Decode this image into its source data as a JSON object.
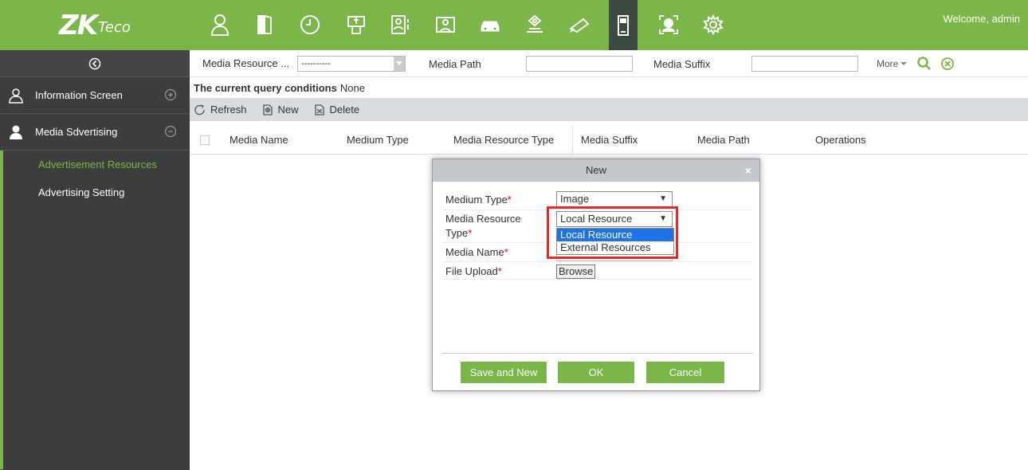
{
  "header": {
    "logo_main": "ZK",
    "logo_sub": "Teco",
    "welcome": "Welcome, admin",
    "nav_icons": [
      "personnel-icon",
      "door-icon",
      "clock-icon",
      "elevator-icon",
      "visitor-icon",
      "meeting-icon",
      "car-icon",
      "patrol-icon",
      "surveillance-icon",
      "media-screen-icon",
      "face-icon",
      "settings-icon"
    ]
  },
  "sidebar": {
    "sections": [
      {
        "label": "Information Screen",
        "expanded": false
      },
      {
        "label": "Media Sdvertising",
        "expanded": true
      }
    ],
    "sub_items": [
      {
        "label": "Advertisement Resources",
        "active": true
      },
      {
        "label": "Advertising Setting",
        "active": false
      }
    ]
  },
  "filter": {
    "media_resource_label": "Media Resource ...",
    "media_resource_value": "----------",
    "media_path_label": "Media Path",
    "media_suffix_label": "Media Suffix",
    "more_label": "More"
  },
  "query": {
    "prefix": "The current query conditions",
    "value": "None"
  },
  "toolbar": {
    "refresh": "Refresh",
    "new": "New",
    "delete": "Delete"
  },
  "table": {
    "columns": [
      "Media Name",
      "Medium Type",
      "Media Resource Type",
      "Media Suffix",
      "Media Path",
      "Operations"
    ]
  },
  "modal": {
    "title": "New",
    "medium_type_label": "Medium Type",
    "medium_type_value": "Image",
    "resource_type_label_1": "Media Resource",
    "resource_type_label_2": "Type",
    "resource_type_value": "Local Resource",
    "resource_options": [
      "Local Resource",
      "External Resources"
    ],
    "media_name_label": "Media Name",
    "file_upload_label": "File Upload",
    "browse_label": "Browse",
    "required_mark": "*",
    "buttons": {
      "save_new": "Save and New",
      "ok": "OK",
      "cancel": "Cancel"
    }
  },
  "colors": {
    "brand_green": "#7ab648",
    "sidebar_bg": "#3d3d3d",
    "highlight_red": "#e8262c",
    "selection_blue": "#1e73e8"
  }
}
